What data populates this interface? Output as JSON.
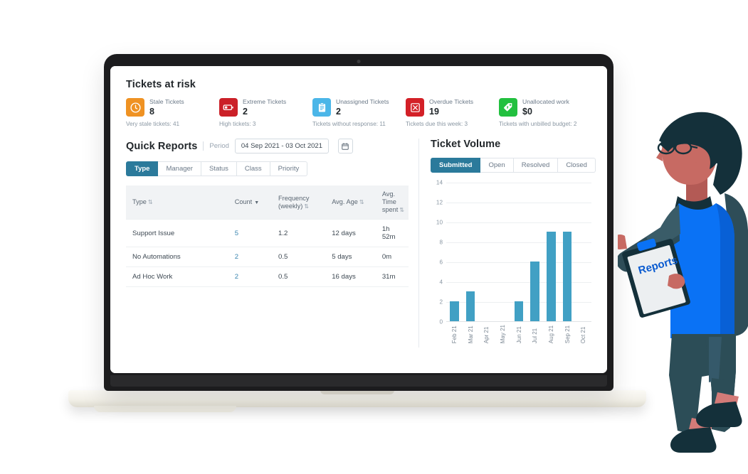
{
  "risk": {
    "title": "Tickets at risk",
    "cards": [
      {
        "icon": "stale-clock-icon",
        "color": "#ef9223",
        "label": "Stale Tickets",
        "value": "8",
        "sub": "Very stale tickets: 41"
      },
      {
        "icon": "low-battery-icon",
        "color": "#cb2028",
        "label": "Extreme Tickets",
        "value": "2",
        "sub": "High tickets: 3"
      },
      {
        "icon": "clipboard-icon",
        "color": "#4bb6e8",
        "label": "Unassigned Tickets",
        "value": "2",
        "sub": "Tickets without response: 11"
      },
      {
        "icon": "overdue-x-icon",
        "color": "#d32027",
        "label": "Overdue Tickets",
        "value": "19",
        "sub": "Tickets due this week: 3"
      },
      {
        "icon": "price-tag-dollar-icon",
        "color": "#22c03f",
        "label": "Unallocated work",
        "value": "$0",
        "sub": "Tickets with unbilled budget: 2"
      }
    ]
  },
  "quick_reports": {
    "title": "Quick Reports",
    "period_label": "Period",
    "period_value": "04 Sep 2021 - 03 Oct 2021",
    "calendar_icon": "calendar-icon",
    "tabs": [
      {
        "label": "Type",
        "active": true
      },
      {
        "label": "Manager",
        "active": false
      },
      {
        "label": "Status",
        "active": false
      },
      {
        "label": "Class",
        "active": false
      },
      {
        "label": "Priority",
        "active": false
      }
    ],
    "table": {
      "columns": [
        {
          "label": "Type",
          "sort": "both"
        },
        {
          "label": "Count",
          "sort": "desc-active"
        },
        {
          "label": "Frequency (weekly)",
          "sort": "both"
        },
        {
          "label": "Avg. Age",
          "sort": "both"
        },
        {
          "label": "Avg. Time spent",
          "sort": "both"
        }
      ],
      "rows": [
        {
          "type": "Support Issue",
          "count": "5",
          "frequency": "1.2",
          "avg_age": "12 days",
          "avg_time": "1h 52m"
        },
        {
          "type": "No Automations",
          "count": "2",
          "frequency": "0.5",
          "avg_age": "5 days",
          "avg_time": "0m"
        },
        {
          "type": "Ad Hoc Work",
          "count": "2",
          "frequency": "0.5",
          "avg_age": "16 days",
          "avg_time": "31m"
        }
      ]
    }
  },
  "ticket_volume": {
    "title": "Ticket Volume",
    "tabs": [
      {
        "label": "Submitted",
        "active": true
      },
      {
        "label": "Open",
        "active": false
      },
      {
        "label": "Resolved",
        "active": false
      },
      {
        "label": "Closed",
        "active": false
      }
    ]
  },
  "chart_data": {
    "type": "bar",
    "title": "Ticket Volume",
    "series_name": "Submitted",
    "categories": [
      "Feb 21",
      "Mar 21",
      "Apr 21",
      "May 21",
      "Jun 21",
      "Jul 21",
      "Aug 21",
      "Sep 21",
      "Oct 21"
    ],
    "values": [
      2,
      3,
      0,
      0,
      2,
      6,
      9,
      9,
      0
    ],
    "yticks": [
      0,
      2,
      4,
      6,
      8,
      10,
      12,
      14
    ],
    "ylim": [
      0,
      14
    ],
    "xlabel": "",
    "ylabel": "",
    "grid": true,
    "legend": "none",
    "bar_color": "#41a0c4"
  },
  "illustration": {
    "clipboard_label": "Reports",
    "colors": {
      "hair": "#14303a",
      "skin": "#c76a63",
      "vest": "#0a72f5",
      "sleeve": "#2e4d58",
      "pants": "#2c4d57",
      "shoe": "#14303a",
      "sock": "#d37b78",
      "paper": "#eceff1"
    }
  }
}
